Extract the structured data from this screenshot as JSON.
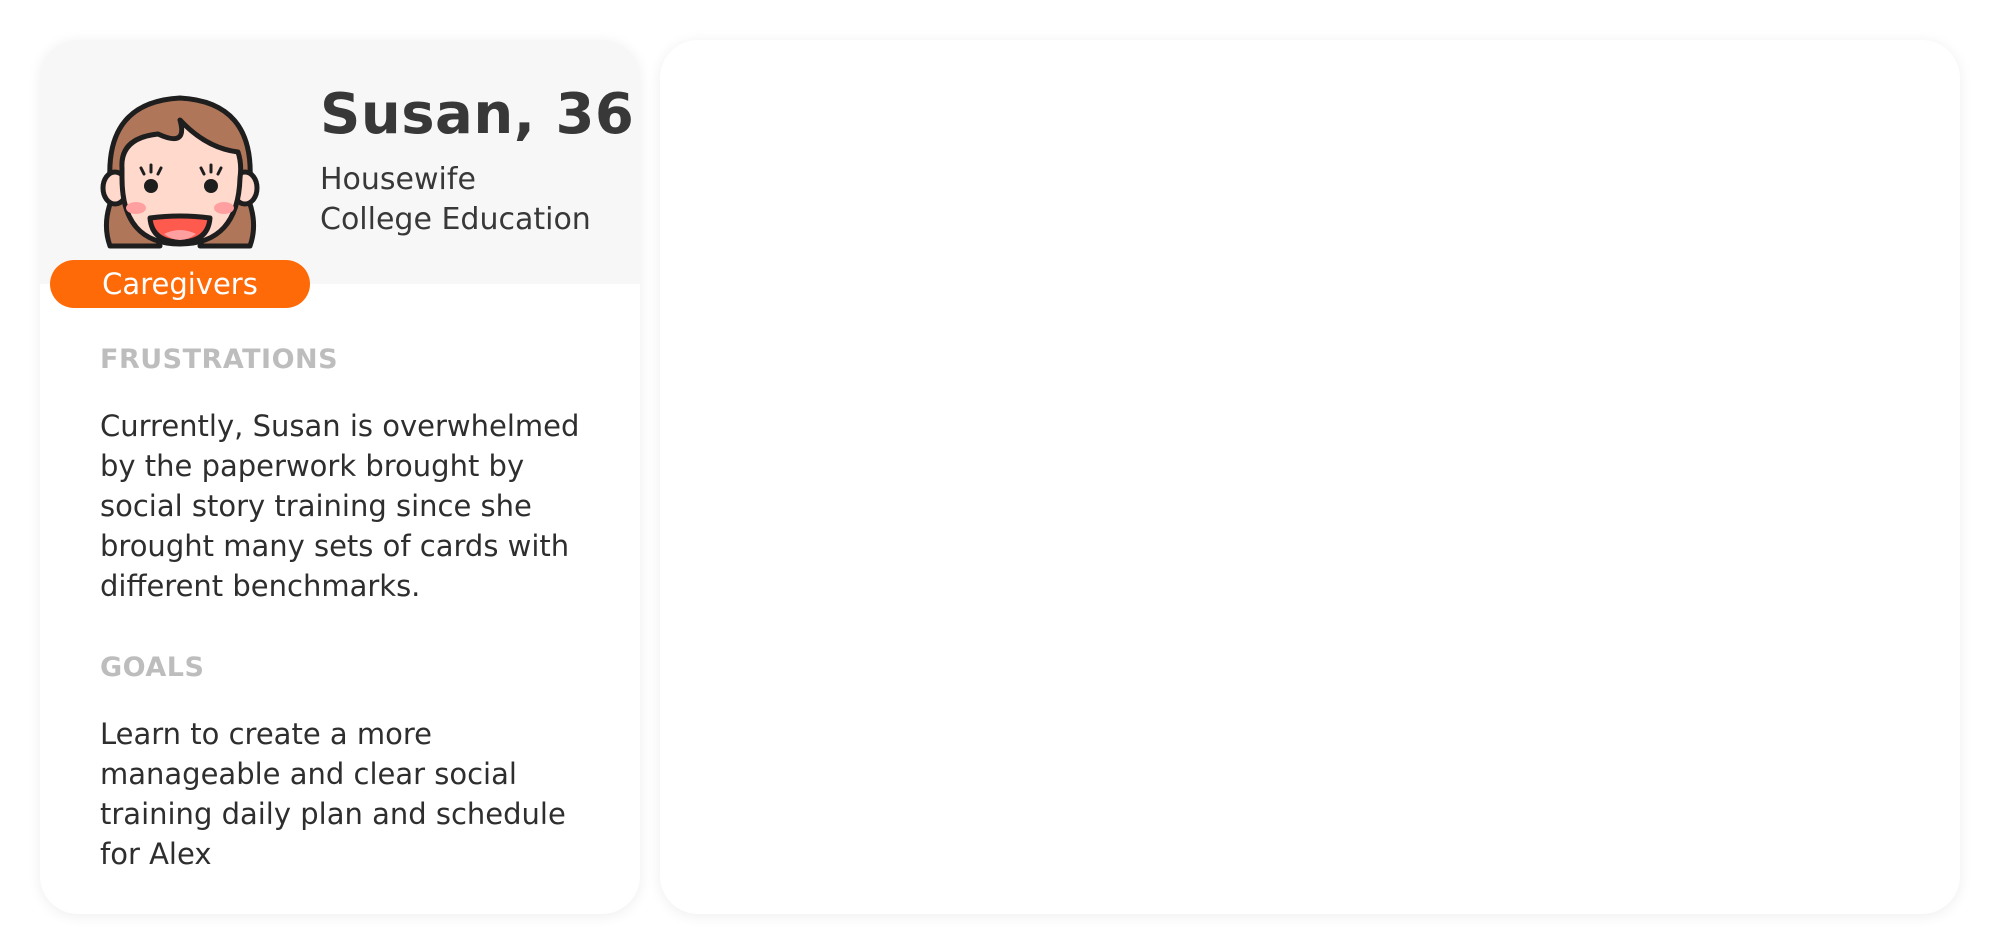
{
  "persona": {
    "name": "Susan, 36",
    "role": "Housewife",
    "education": "College Education",
    "category": "Caregivers",
    "avatar_icon": "girl-avatar-icon",
    "badge_color": "#ff6a09"
  },
  "sections": {
    "frustrations": {
      "heading": "FRUSTRATIONS",
      "body": "Currently, Susan is overwhelmed by the paperwork brought by social story training since she brought many sets of cards with different benchmarks."
    },
    "goals": {
      "heading": "GOALS",
      "body": "Learn to create a more manageable and clear social training daily plan and schedule for Alex"
    }
  }
}
